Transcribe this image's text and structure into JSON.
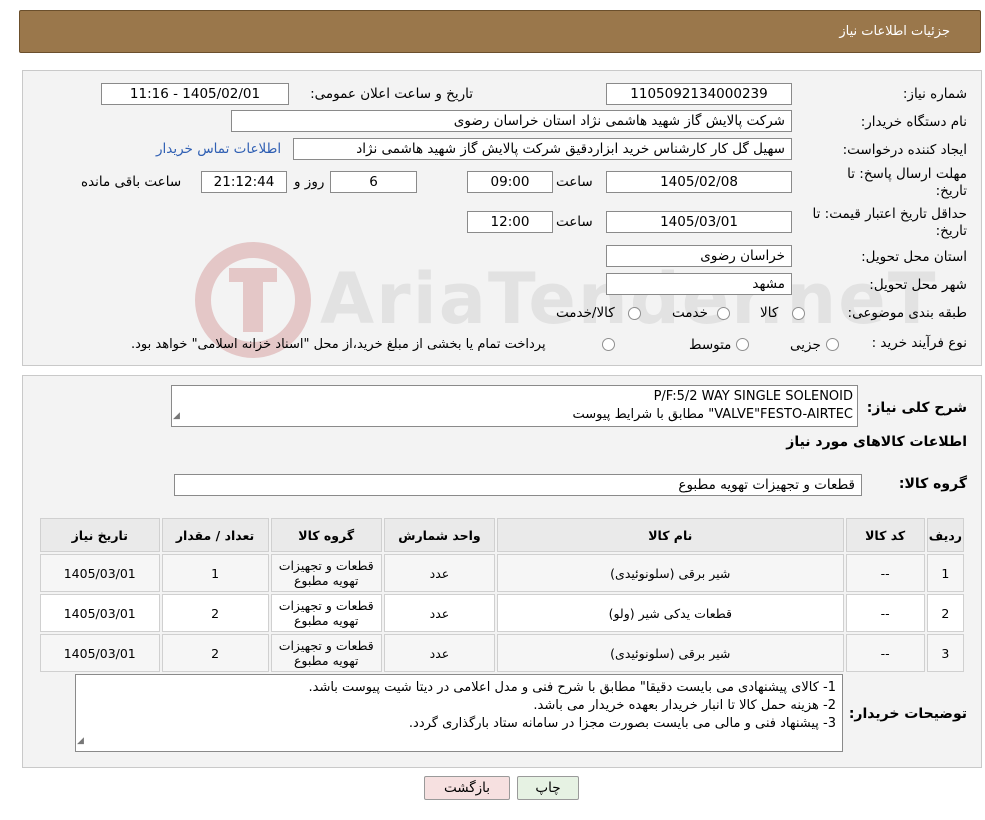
{
  "header": {
    "title": "جزئیات اطلاعات نیاز"
  },
  "form": {
    "need_number_label": "شماره نیاز:",
    "need_number": "1105092134000239",
    "announce_label": "تاریخ و ساعت اعلان عمومی:",
    "announce_value": "1405/02/01 - 11:16",
    "buyer_org_label": "نام دستگاه خریدار:",
    "buyer_org": "شرکت پالایش گاز شهید هاشمی نژاد   استان خراسان رضوی",
    "creator_label": "ایجاد کننده درخواست:",
    "creator": "سهیل گل کار کارشناس خرید ابزاردقیق شرکت پالایش گاز شهید هاشمی نژاد",
    "contact_link": "اطلاعات تماس خریدار",
    "deadline_label_1": "مهلت ارسال پاسخ: تا",
    "deadline_label_2": "تاریخ:",
    "deadline_date": "1405/02/08",
    "time_label": "ساعت",
    "deadline_time": "09:00",
    "remaining_days": "6",
    "days_label": "روز و",
    "remaining_time": "21:12:44",
    "remaining_label": "ساعت باقی مانده",
    "validity_label_1": "حداقل تاریخ اعتبار قیمت: تا",
    "validity_label_2": "تاریخ:",
    "validity_date": "1405/03/01",
    "validity_time": "12:00",
    "province_label": "استان محل تحویل:",
    "province": "خراسان رضوی",
    "city_label": "شهر محل تحویل:",
    "city": "مشهد",
    "category_label": "طبقه بندی موضوعی:",
    "category_options": [
      "کالا",
      "خدمت",
      "کالا/خدمت"
    ],
    "purchase_type_label": "نوع فرآیند خرید :",
    "purchase_options": [
      "جزیی",
      "متوسط"
    ],
    "purchase_note": "پرداخت تمام یا بخشی از مبلغ خرید،از محل \"اسناد خزانه اسلامی\" خواهد بود."
  },
  "summary": {
    "label": "شرح کلی نیاز:",
    "line1": "P/F:5/2 WAY SINGLE SOLENOID",
    "line2": "VALVE\"FESTO-AIRTEC\" مطابق با شرایط پیوست"
  },
  "goods_section_title": "اطلاعات کالاهای مورد نیاز",
  "goods_group": {
    "label": "گروه کالا:",
    "value": "قطعات و تجهیزات تهویه مطبوع"
  },
  "table": {
    "headers": [
      "ردیف",
      "کد کالا",
      "نام کالا",
      "واحد شمارش",
      "گروه کالا",
      "تعداد / مقدار",
      "تاریخ نیاز"
    ],
    "rows": [
      [
        "1",
        "--",
        "شیر برقی (سلونوئیدی)",
        "عدد",
        "قطعات و تجهیزات تهویه مطبوع",
        "1",
        "1405/03/01"
      ],
      [
        "2",
        "--",
        "قطعات یدکی شیر (ولو)",
        "عدد",
        "قطعات و تجهیزات تهویه مطبوع",
        "2",
        "1405/03/01"
      ],
      [
        "3",
        "--",
        "شیر برقی (سلونوئیدی)",
        "عدد",
        "قطعات و تجهیزات تهویه مطبوع",
        "2",
        "1405/03/01"
      ]
    ]
  },
  "notes": {
    "label": "توضیحات خریدار:",
    "lines": [
      "1-     کالای پیشنهادی می بایست دقیقا\" مطابق با شرح فنی و مدل اعلامی در دیتا شیت پیوست باشد.",
      "2-     هزینه حمل کالا تا انبار خریدار بعهده خریدار می باشد.",
      "3-     پیشنهاد فنی و مالی می بایست بصورت مجزا در سامانه ستاد بارگذاری گردد."
    ]
  },
  "buttons": {
    "print": "چاپ",
    "back": "بازگشت"
  },
  "watermark": {
    "text": "AriaTender.neT"
  },
  "colors": {
    "header": "#9a774b",
    "link": "#2f5fb3",
    "back_button": "#f6e0e0",
    "print_button": "#e6f2e3"
  }
}
